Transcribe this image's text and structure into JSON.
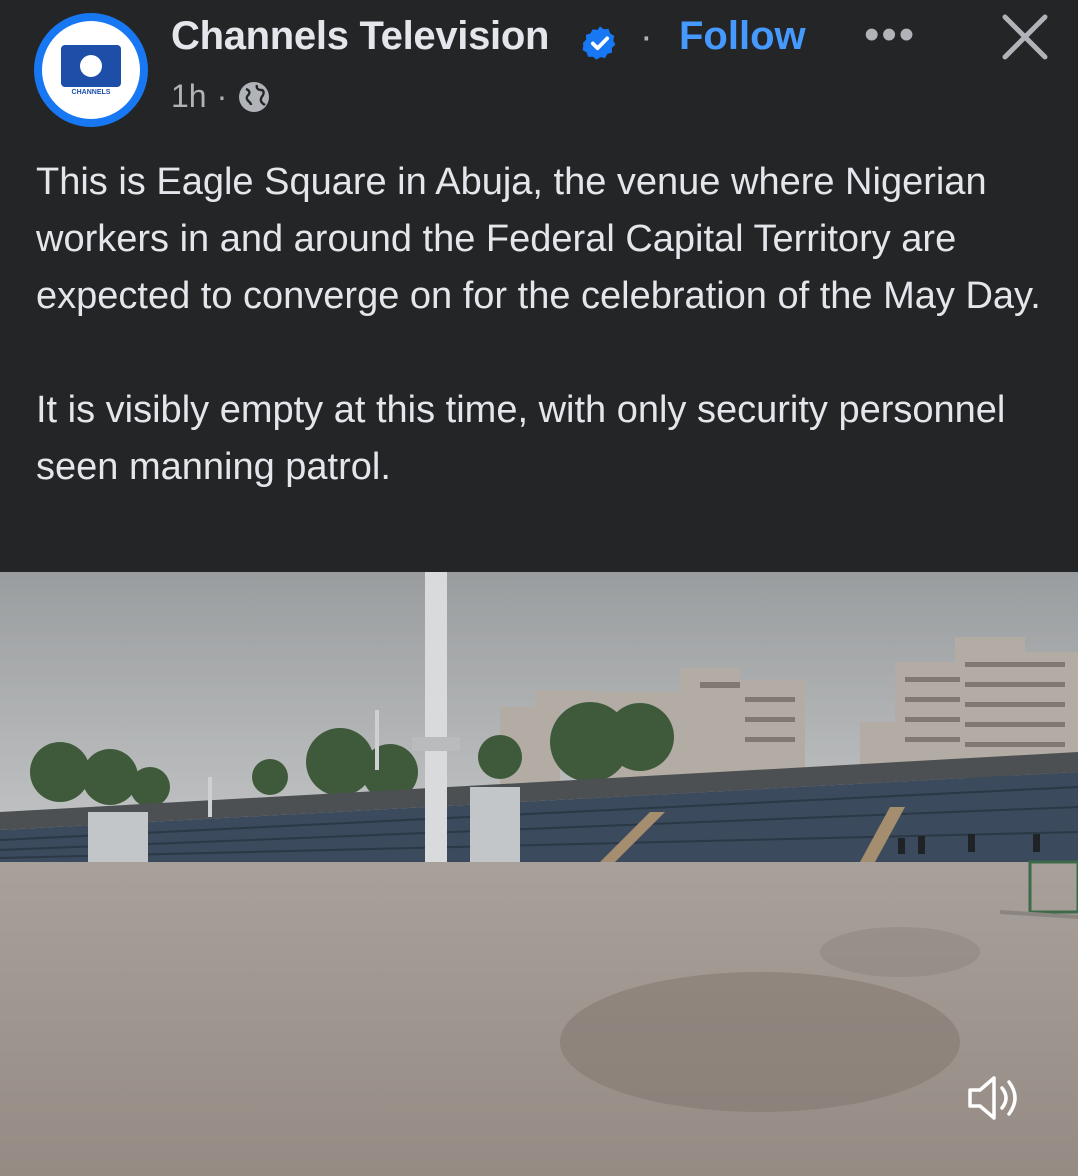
{
  "post": {
    "page_name": "Channels Television",
    "follow_label": "Follow",
    "separator": "·",
    "more_label": "•••",
    "time": "1h",
    "meta_separator": "·",
    "text": "This is Eagle Square in Abuja, the venue where Nigerian workers in and around the Federal Capital Territory are expected to converge on for the celebration of the May Day.\n\nIt is visibly empty at this time, with only security personnel seen manning patrol.",
    "avatar_logo_text": "CHANNELS"
  },
  "icons": {
    "verified": "verified-badge-icon",
    "audience": "globe-icon",
    "close": "close-icon",
    "more": "more-options-icon",
    "sound": "speaker-icon"
  },
  "colors": {
    "background": "#242526",
    "accent": "#4599ff",
    "verified": "#1877f2"
  }
}
